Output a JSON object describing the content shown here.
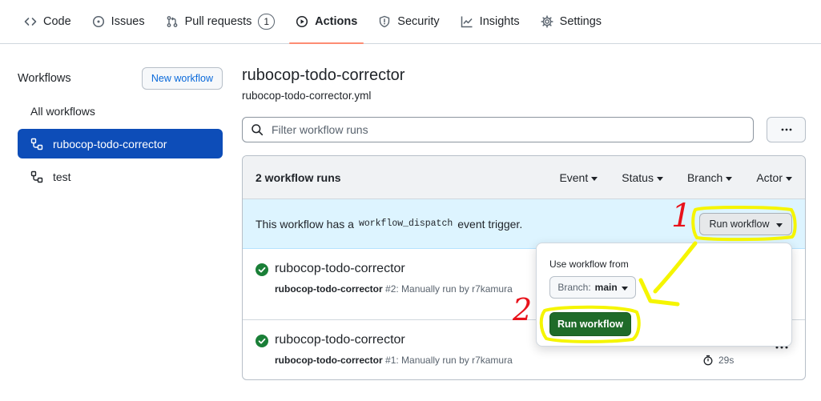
{
  "tabs": [
    {
      "label": "Code",
      "icon": "code-icon"
    },
    {
      "label": "Issues",
      "icon": "issue-opened-icon"
    },
    {
      "label": "Pull requests",
      "icon": "git-pull-request-icon",
      "count": "1"
    },
    {
      "label": "Actions",
      "icon": "play-icon",
      "selected": true
    },
    {
      "label": "Security",
      "icon": "shield-icon"
    },
    {
      "label": "Insights",
      "icon": "graph-icon"
    },
    {
      "label": "Settings",
      "icon": "gear-icon"
    }
  ],
  "sidebar": {
    "title": "Workflows",
    "new_workflow_label": "New workflow",
    "all_workflows_label": "All workflows",
    "items": [
      {
        "label": "rubocop-todo-corrector",
        "icon": "workflow-icon",
        "active": true
      },
      {
        "label": "test",
        "icon": "workflow-icon",
        "active": false
      }
    ]
  },
  "main": {
    "title": "rubocop-todo-corrector",
    "filename": "rubocop-todo-corrector.yml",
    "filter_placeholder": "Filter workflow runs"
  },
  "runs": {
    "count_label": "2 workflow runs",
    "filters": [
      "Event",
      "Status",
      "Branch",
      "Actor"
    ],
    "dispatch": {
      "prefix": "This workflow has a",
      "code": "workflow_dispatch",
      "suffix": "event trigger.",
      "run_button_label": "Run workflow"
    },
    "items": [
      {
        "title": "rubocop-todo-corrector",
        "workflow": "rubocop-todo-corrector",
        "meta": "#2: Manually run by r7kamura",
        "status": "success",
        "duration": ""
      },
      {
        "title": "rubocop-todo-corrector",
        "workflow": "rubocop-todo-corrector",
        "meta": "#1: Manually run by r7kamura",
        "status": "success",
        "duration": "29s"
      }
    ]
  },
  "popup": {
    "label": "Use workflow from",
    "branch_prefix": "Branch:",
    "branch_value": "main",
    "run_button_label": "Run workflow"
  },
  "annotations": {
    "step1": "1",
    "step2": "2",
    "highlight_color": "#f5f500",
    "number_color": "#e8121b"
  },
  "colors": {
    "accent_underline": "#fd8c73",
    "active_sidebar": "#0d4db8",
    "success_green": "#1a7f37",
    "primary_button": "#1f6b29",
    "dispatch_banner": "#ddf4ff"
  }
}
